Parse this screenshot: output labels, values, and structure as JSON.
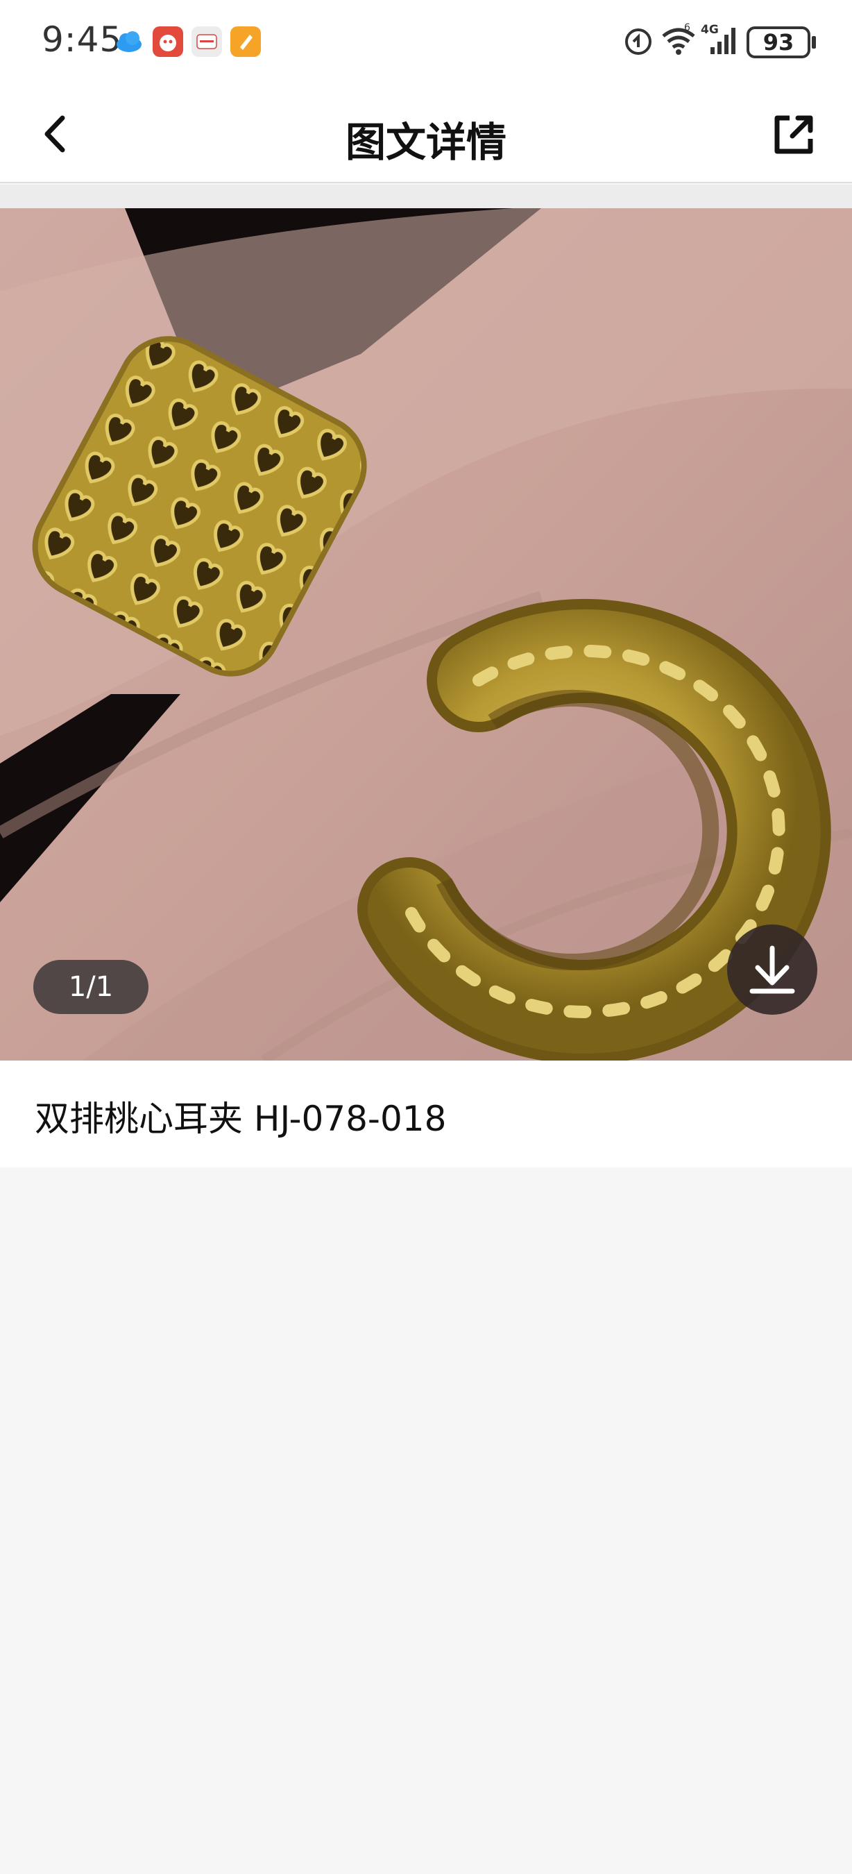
{
  "status_bar": {
    "time": "9:45",
    "battery": "93",
    "signal_label": "4G",
    "icons": [
      "cloud-icon",
      "app-notification-icon",
      "huawei-app-icon",
      "app-notification-icon",
      "nfc-icon",
      "wifi-icon",
      "signal-icon",
      "battery-icon"
    ]
  },
  "nav": {
    "title": "图文详情",
    "back_icon": "chevron-left-icon",
    "share_icon": "share-external-icon"
  },
  "gallery": {
    "counter": "1/1",
    "download_icon": "download-icon"
  },
  "caption": {
    "text": "双排桃心耳夹 HJ-078-018"
  },
  "colors": {
    "background": "#f6f6f6",
    "surface": "#ffffff",
    "overlay": "#3c3737"
  }
}
